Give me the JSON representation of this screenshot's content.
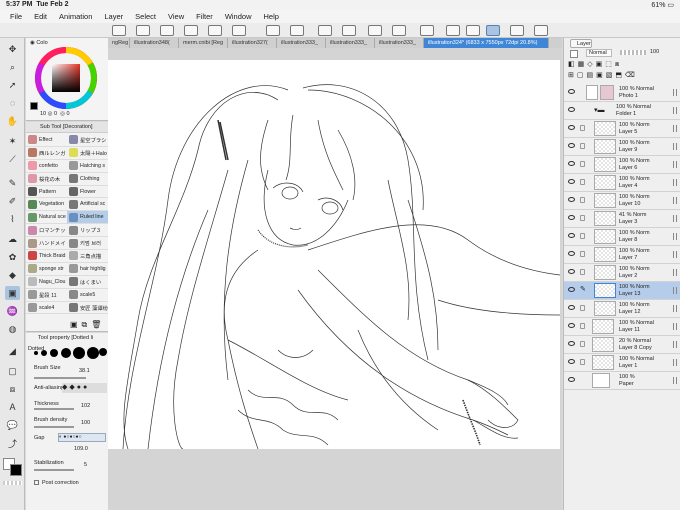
{
  "status": {
    "time": "5:37 PM",
    "date": "Tue Feb 2",
    "battery": "61%"
  },
  "menu": [
    "File",
    "Edit",
    "Animation",
    "Layer",
    "Select",
    "View",
    "Filter",
    "Window",
    "Help"
  ],
  "tabs": [
    "ngReg",
    "illustration348(",
    "merm.cnibi [Reg",
    "illustration327(",
    "illustration333_",
    "illustration333_",
    "illustration333_",
    "illustration324* (6833 x 7550px 72dpi 20.8%)"
  ],
  "color_panel": {
    "label": "Colo",
    "values": [
      "10",
      "0",
      "0"
    ],
    "accent": "#3f86d6"
  },
  "subtool": {
    "title": "Sub Tool [Decoration]",
    "items": [
      "Effect",
      "星空ブラシ",
      "西ルレンガ",
      "太陽＋Halo",
      "confetto",
      "Hatching s",
      "桜花の木",
      "Clothing",
      "Pattern",
      "Flower",
      "Vegetation",
      "Artificial sc",
      "Natural sce",
      "Ruled line",
      "ロマンチッ",
      "リップ３",
      "ハンドメイ",
      "키멈 브러",
      "Thick Braid",
      "三角点描",
      "sponge str",
      "hair highlig",
      "Nagu_Clou",
      "はくまい",
      "星段 11",
      "scale5",
      "scale4",
      "安匠 藻谭纷"
    ]
  },
  "tool_property": {
    "title": "Tool property [Dotted li",
    "preset": "Dotted",
    "brush_size_label": "Brush Size",
    "brush_size": "38.1",
    "anti_aliasing_label": "Anti-aliasing",
    "thickness_label": "Thickness",
    "thickness": "102",
    "brush_density_label": "Brush density",
    "brush_density": "100",
    "gap_label": "Gap",
    "gap": "109.0",
    "stabilization_label": "Stabilization",
    "stabilization": "5",
    "post_correction_label": "Post correction"
  },
  "layer_panel": {
    "title": "Layer",
    "blend": "Normal",
    "opacity": "100",
    "layers": [
      {
        "op": "100 %",
        "mode": "Normal",
        "name": "Photo 1"
      },
      {
        "op": "100 %",
        "mode": "Normal",
        "name": "Folder 1"
      },
      {
        "op": "100 %",
        "mode": "Norm",
        "name": "Layer 5"
      },
      {
        "op": "100 %",
        "mode": "Norm",
        "name": "Layer 9"
      },
      {
        "op": "100 %",
        "mode": "Norm",
        "name": "Layer 6"
      },
      {
        "op": "100 %",
        "mode": "Norm",
        "name": "Layer 4"
      },
      {
        "op": "100 %",
        "mode": "Norm",
        "name": "Layer 10"
      },
      {
        "op": "41 %",
        "mode": "Norm",
        "name": "Layer 3"
      },
      {
        "op": "100 %",
        "mode": "Norm",
        "name": "Layer 8"
      },
      {
        "op": "100 %",
        "mode": "Norm",
        "name": "Layer 7"
      },
      {
        "op": "100 %",
        "mode": "Norm",
        "name": "Layer 2"
      },
      {
        "op": "100 %",
        "mode": "Norm",
        "name": "Layer 13"
      },
      {
        "op": "100 %",
        "mode": "Norm",
        "name": "Layer 12"
      },
      {
        "op": "100 %",
        "mode": "Normal",
        "name": "Layer 11"
      },
      {
        "op": "20 %",
        "mode": "Normal",
        "name": "Layer 8 Copy"
      },
      {
        "op": "100 %",
        "mode": "Normal",
        "name": "Layer 1"
      },
      {
        "op": "100 %",
        "mode": "",
        "name": "Paper"
      }
    ]
  }
}
